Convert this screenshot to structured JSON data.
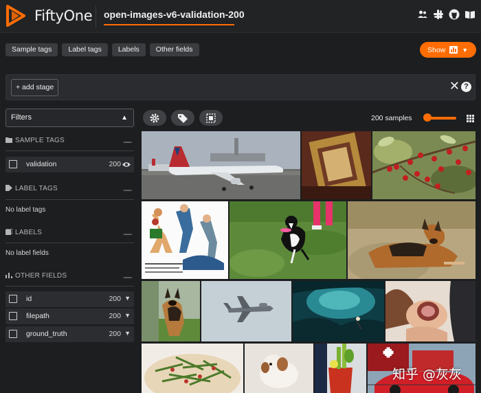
{
  "app": {
    "brand": "FiftyOne",
    "dataset_name": "open-images-v6-validation-200",
    "accent": "#ff6d04"
  },
  "header_icons": [
    "team-icon",
    "slack-icon",
    "github-icon",
    "docs-book-icon"
  ],
  "tabs": [
    "Sample tags",
    "Label tags",
    "Labels",
    "Other fields"
  ],
  "show_button": {
    "label": "Show",
    "icon": "bar-chart-icon"
  },
  "stage_bar": {
    "add_stage_label": "+ add stage",
    "close": "✕",
    "help": "?"
  },
  "sidebar": {
    "filter_mode": "Filters",
    "groups": {
      "sample_tags": {
        "title": "SAMPLE TAGS",
        "items": [
          {
            "name": "validation",
            "count": "200"
          }
        ]
      },
      "label_tags": {
        "title": "LABEL TAGS",
        "empty_text": "No label tags"
      },
      "labels": {
        "title": "LABELS",
        "empty_text": "No label fields"
      },
      "other_fields": {
        "title": "OTHER FIELDS",
        "items": [
          {
            "name": "id",
            "count": "200"
          },
          {
            "name": "filepath",
            "count": "200"
          },
          {
            "name": "ground_truth",
            "count": "200"
          }
        ]
      }
    }
  },
  "grid": {
    "samples_label": "200 samples",
    "tool_icons": [
      "settings-icon",
      "tag-icon",
      "select-box-icon"
    ]
  },
  "images": [
    "airplane-on-tarmac",
    "ornate-gold-frame",
    "red-berries-branch",
    "boxing-illustration",
    "dog-with-frisbee-on-grass",
    "german-shepherd-lying",
    "german-shepherd-walking",
    "fighter-jet-in-sky",
    "underwater-cave-diver",
    "hands-holding-shell",
    "green-bean-dish",
    "white-brown-dog",
    "bloody-mary-drink",
    "red-sports-car"
  ],
  "watermark": "知乎 @灰灰"
}
